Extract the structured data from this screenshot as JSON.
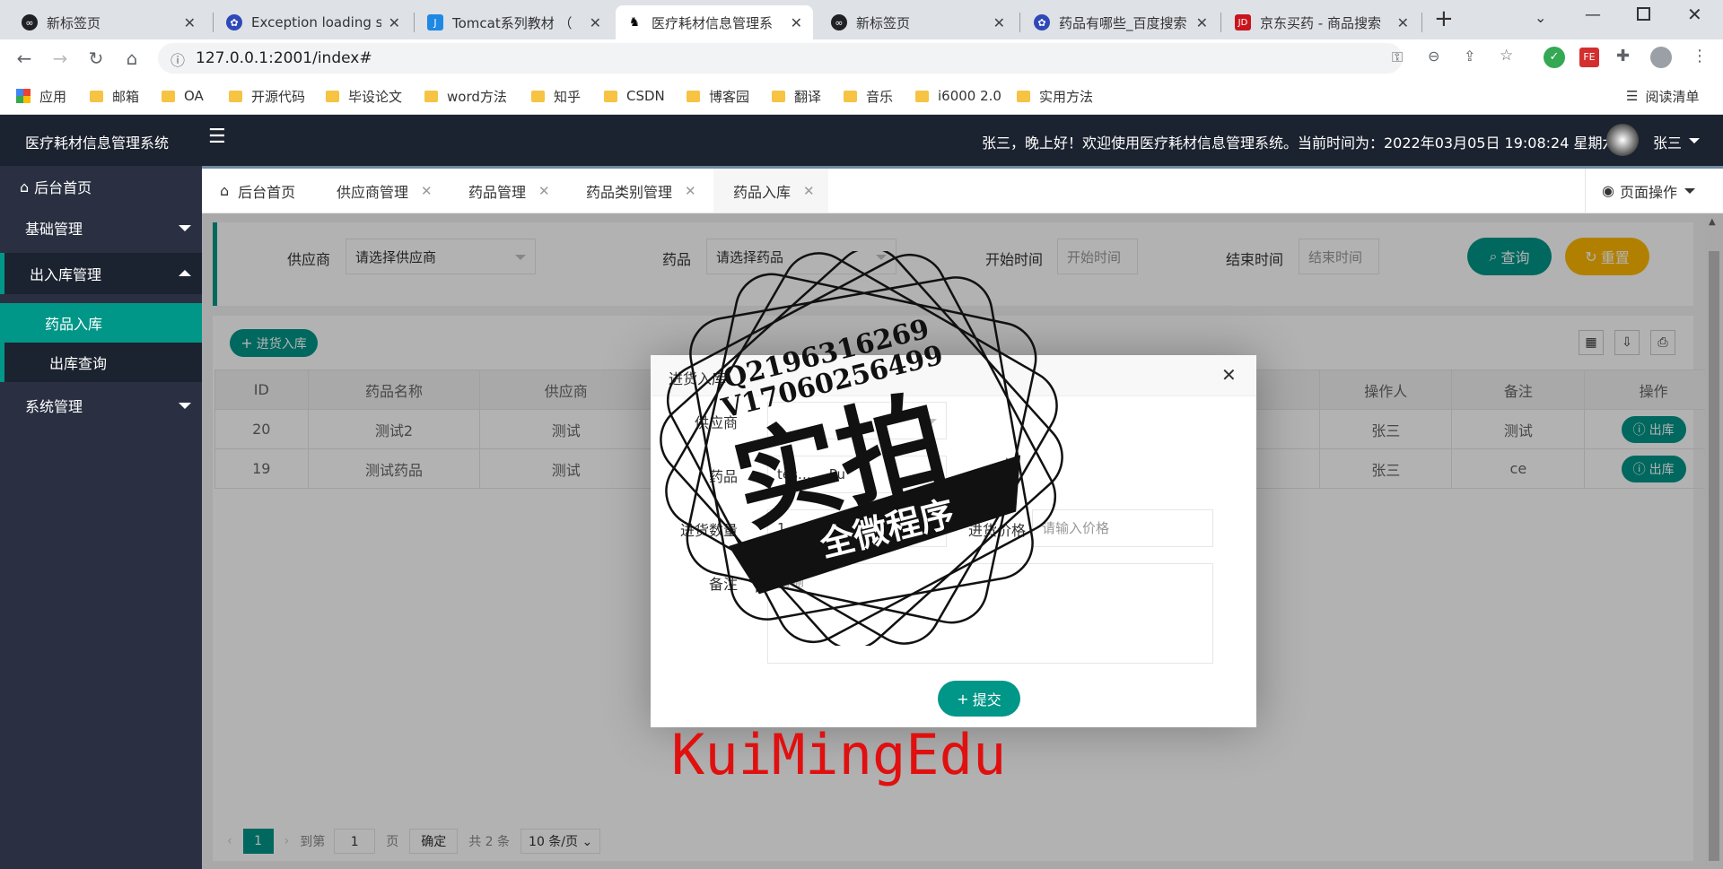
{
  "browser": {
    "tabs": [
      {
        "title": "新标签页",
        "favicon": "chrome-icon",
        "active": false
      },
      {
        "title": "Exception loading s",
        "favicon": "paw-icon",
        "active": false
      },
      {
        "title": "Tomcat系列教材 （",
        "favicon": "j-icon",
        "active": false
      },
      {
        "title": "医疗耗材信息管理系",
        "favicon": "horse-icon",
        "active": true
      },
      {
        "title": "新标签页",
        "favicon": "chrome-icon",
        "active": false
      },
      {
        "title": "药品有哪些_百度搜索",
        "favicon": "paw-icon",
        "active": false
      },
      {
        "title": "京东买药 - 商品搜索",
        "favicon": "jd-icon",
        "active": false
      }
    ],
    "new_tab": "+",
    "url": "127.0.0.1:2001/index#",
    "bookmarks": [
      "应用",
      "邮箱",
      "OA",
      "开源代码",
      "毕设论文",
      "word方法",
      "知乎",
      "CSDN",
      "博客园",
      "翻译",
      "音乐",
      "i6000 2.0",
      "实用方法"
    ],
    "reading_list": "阅读清单"
  },
  "app": {
    "title": "医疗耗材信息管理系统",
    "menu_icon": "☰",
    "welcome": "张三，晚上好！欢迎使用医疗耗材信息管理系统。当前时间为：2022年03月05日 19:08:24 星期六",
    "user": "张三"
  },
  "sidebar": {
    "home": "后台首页",
    "items": [
      {
        "label": "基础管理"
      },
      {
        "label": "出入库管理"
      },
      {
        "label": "药品入库"
      },
      {
        "label": "出库查询"
      },
      {
        "label": "系统管理"
      }
    ]
  },
  "page_tabs": {
    "items": [
      "后台首页",
      "供应商管理",
      "药品管理",
      "药品类别管理",
      "药品入库"
    ],
    "page_ops": "页面操作"
  },
  "search": {
    "supplier_label": "供应商",
    "supplier_value": "请选择供应商",
    "drug_label": "药品",
    "drug_value": "请选择药品",
    "start_label": "开始时间",
    "start_placeholder": "开始时间",
    "end_label": "结束时间",
    "end_placeholder": "结束时间",
    "query_btn": "查询",
    "reset_btn": "重置"
  },
  "table": {
    "add_btn": "进货入库",
    "columns": [
      "ID",
      "药品名称",
      "供应商",
      "操作人",
      "备注",
      "操作"
    ],
    "rows": [
      {
        "id": "20",
        "name": "测试2",
        "supplier": "测试",
        "operator": "张三",
        "remark": "测试",
        "action": "出库"
      },
      {
        "id": "19",
        "name": "测试药品",
        "supplier": "测试",
        "operator": "张三",
        "remark": "ce",
        "action": "出库"
      }
    ]
  },
  "pager": {
    "current": "1",
    "goto": "到第",
    "page_input": "1",
    "page_unit": "页",
    "confirm": "确定",
    "total": "共 2 条",
    "size": "10 条/页"
  },
  "modal": {
    "title": "进货入库",
    "supplier_label": "供应商",
    "drug_label": "药品",
    "drug_value": "tes… …Pu",
    "qty_label": "进货数量",
    "qty_value": "1",
    "price_label": "进货价格",
    "price_placeholder": "请输入价格",
    "remark_label": "备注",
    "remark_placeholder": "请输",
    "submit": "提交"
  },
  "watermark": {
    "line1": "Q2196316269",
    "line2": "V17060256499",
    "big": "实拍",
    "banner": "全微程序",
    "bottom": "KuiMingEdu"
  },
  "colors": {
    "accent": "#009688",
    "warn": "#FFB800",
    "header": "#1c2330",
    "sidebar": "#2a3042",
    "wm_red": "#e01010"
  }
}
